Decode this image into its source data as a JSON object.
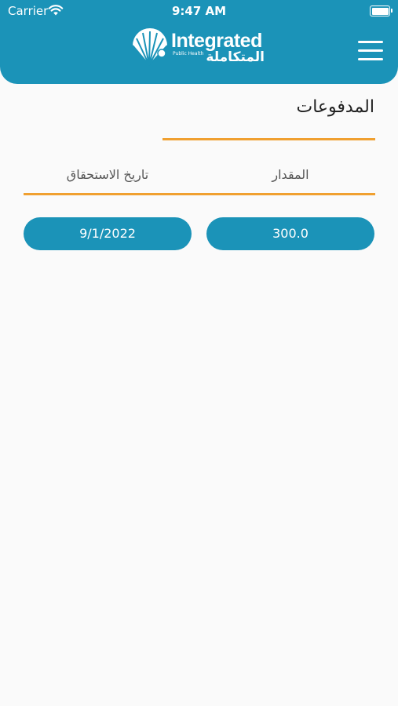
{
  "status_bar": {
    "carrier": "Carrier",
    "time": "9:47 AM"
  },
  "header": {
    "logo": {
      "english": "Integrated",
      "subtitle": "Public Health",
      "arabic": "المتكاملة"
    },
    "menu_icon": "hamburger-icon"
  },
  "page": {
    "title": "المدفوعات"
  },
  "table": {
    "headers": {
      "amount": "المقدار",
      "due_date": "تاريخ الاستحقاق"
    },
    "rows": [
      {
        "amount": "300.0",
        "due_date": "9/1/2022"
      }
    ]
  },
  "colors": {
    "primary": "#1b93b8",
    "accent": "#f0a030",
    "background": "#fafafa"
  }
}
